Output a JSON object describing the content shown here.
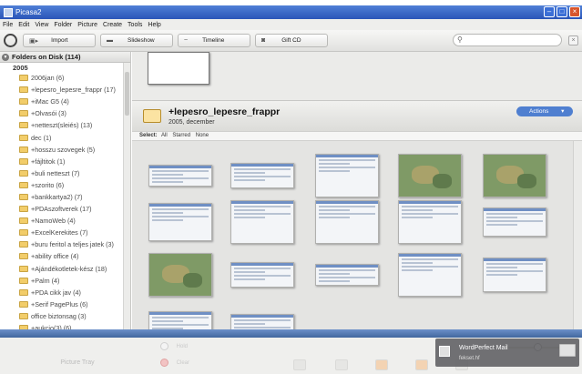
{
  "window": {
    "title": "Picasa2"
  },
  "menu": [
    "File",
    "Edit",
    "View",
    "Folder",
    "Picture",
    "Create",
    "Tools",
    "Help"
  ],
  "toolbar": {
    "import_label": "Import",
    "slideshow_label": "Slideshow",
    "timeline_label": "Timeline",
    "giftcd_label": "Gift CD",
    "search_placeholder": ""
  },
  "sidebar": {
    "header": "Folders on Disk (114)",
    "year": "2005",
    "folders": [
      "2006jan (6)",
      "+lepesro_lepesre_frappr (17)",
      "+iMac G5 (4)",
      "+Olvasói (3)",
      "+netteszt(sleiés) (13)",
      "dec (1)",
      "+hosszu szovegek (5)",
      "+fájltitok (1)",
      "+buli netteszt (7)",
      "+szorito (6)",
      "+bankkartya2) (7)",
      "+PDAszoftverek (17)",
      "+NamoWeb (4)",
      "+ExcelKerekites (7)",
      "+buru feritol a teljes jatek (3)",
      "+ability office (4)",
      "+Ajándékotletek-kész (18)",
      "+Palm (4)",
      "+PDA cikk jav (4)",
      "+Serif PagePlus (6)",
      "office biztonsag (3)",
      "+aukcio(3) (6)"
    ]
  },
  "folder": {
    "title": "+lepesro_lepesre_frappr",
    "date": "2005, december",
    "actions_label": "Actions",
    "select_label": "Select:",
    "select_options": [
      "All",
      "Starred",
      "None"
    ]
  },
  "thumbnails": [
    {
      "kind": "page"
    },
    {
      "kind": "page"
    },
    {
      "kind": "page"
    },
    {
      "kind": "map"
    },
    {
      "kind": "map"
    },
    {
      "kind": "page"
    },
    {
      "kind": "page"
    },
    {
      "kind": "page"
    },
    {
      "kind": "page"
    },
    {
      "kind": "page"
    },
    {
      "kind": "map"
    },
    {
      "kind": "page"
    },
    {
      "kind": "page"
    },
    {
      "kind": "page"
    },
    {
      "kind": "page"
    },
    {
      "kind": "page"
    },
    {
      "kind": "page"
    }
  ],
  "tray": {
    "label": "Picture Tray",
    "hold_label": "Hold",
    "clear_label": "Clear"
  },
  "notification": {
    "title": "WordPerfect Mail",
    "subtitle": "fekset.hf"
  },
  "colors": {
    "titlebar": "#2a55b8",
    "accent": "#4f7fd0",
    "folder_icon": "#f2cd6a"
  }
}
